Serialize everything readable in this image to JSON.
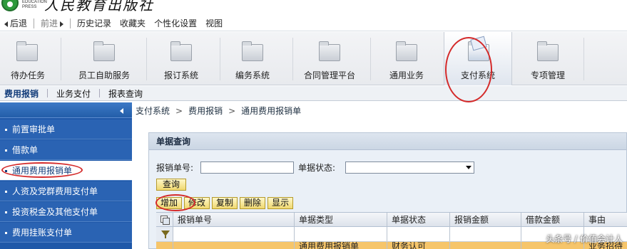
{
  "header": {
    "logo_en_line1": "EDUCATION",
    "logo_en_line2": "PRESS",
    "logo_cn": "人民教育出版社"
  },
  "menubar": {
    "back": "后退",
    "forward": "前进",
    "history": "历史记录",
    "favorites": "收藏夹",
    "personalize": "个性化设置",
    "view": "视图"
  },
  "launchpad": {
    "tiles": [
      {
        "label": "待办任务",
        "icon": "folder-icon"
      },
      {
        "label": "员工自助服务",
        "icon": "folder-icon"
      },
      {
        "label": "报订系统",
        "icon": "folder-icon"
      },
      {
        "label": "编务系统",
        "icon": "folder-icon"
      },
      {
        "label": "合同管理平台",
        "icon": "folder-icon"
      },
      {
        "label": "通用业务",
        "icon": "folder-icon"
      },
      {
        "label": "支付系统",
        "icon": "folder-open-icon"
      },
      {
        "label": "专项管理",
        "icon": "folder-icon"
      }
    ],
    "active": "支付系统"
  },
  "subnav": {
    "tabs": [
      "费用报销",
      "业务支付",
      "报表查询"
    ],
    "active": "费用报销"
  },
  "sidebar": {
    "items": [
      {
        "label": "前置审批单"
      },
      {
        "label": "借款单"
      },
      {
        "label": "通用费用报销单"
      },
      {
        "label": "人资及党群费用支付单"
      },
      {
        "label": "投资税金及其他支付单"
      },
      {
        "label": "费用挂账支付单"
      }
    ],
    "active": "通用费用报销单"
  },
  "breadcrumb": {
    "parts": [
      "支付系统",
      "费用报销",
      "通用费用报销单"
    ],
    "separator": ">"
  },
  "panel": {
    "title": "单据查询",
    "form": {
      "doc_no_label": "报销单号:",
      "doc_no_value": "",
      "status_label": "单据状态:",
      "status_value": ""
    },
    "query_button": "查询",
    "toolbar": [
      "增加",
      "修改",
      "复制",
      "删除",
      "显示"
    ],
    "columns": [
      "报销单号",
      "单据类型",
      "单据状态",
      "报销金额",
      "借款金额",
      "事由"
    ],
    "rows": [
      [
        "",
        "",
        "",
        "",
        "",
        ""
      ],
      [
        "",
        "通用费用报销单",
        "财务认可",
        "",
        "",
        "业务招待"
      ]
    ]
  },
  "watermark": "头条号 / 价值会计人",
  "colors": {
    "sidebar_bg": "#1f58a8",
    "annotation_red": "#d42a2a",
    "button_yellow": "#f0d870"
  }
}
